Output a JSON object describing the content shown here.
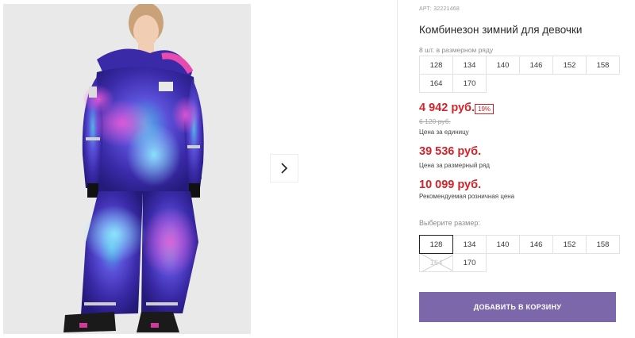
{
  "gallery": {
    "next_icon": "chevron-right-icon"
  },
  "product": {
    "sku": "АРТ: 32221468",
    "title": "Комбинезон зимний для девочки",
    "set_label": "8 шт. в размерном ряду",
    "set_sizes": [
      "128",
      "134",
      "140",
      "146",
      "152",
      "158",
      "164",
      "170"
    ]
  },
  "prices": {
    "unit_price": "4 942 руб.",
    "discount": "19%",
    "old_price": "6 120 руб.",
    "unit_label": "Цена за единицу",
    "pack_price": "39 536 руб.",
    "pack_label": "Цена за размерный ряд",
    "rrp_price": "10 099 руб.",
    "rrp_label": "Рекомендуемая розничная цена"
  },
  "size_select": {
    "label": "Выберите размер:",
    "sizes": [
      "128",
      "134",
      "140",
      "146",
      "152",
      "158",
      "164",
      "170"
    ],
    "selected": "128",
    "unavailable": [
      "164"
    ]
  },
  "cart": {
    "button_label": "ДОБАВИТЬ В КОРЗИНУ"
  },
  "colors": {
    "price_red": "#d4232a",
    "button_purple": "#7b67a9"
  }
}
